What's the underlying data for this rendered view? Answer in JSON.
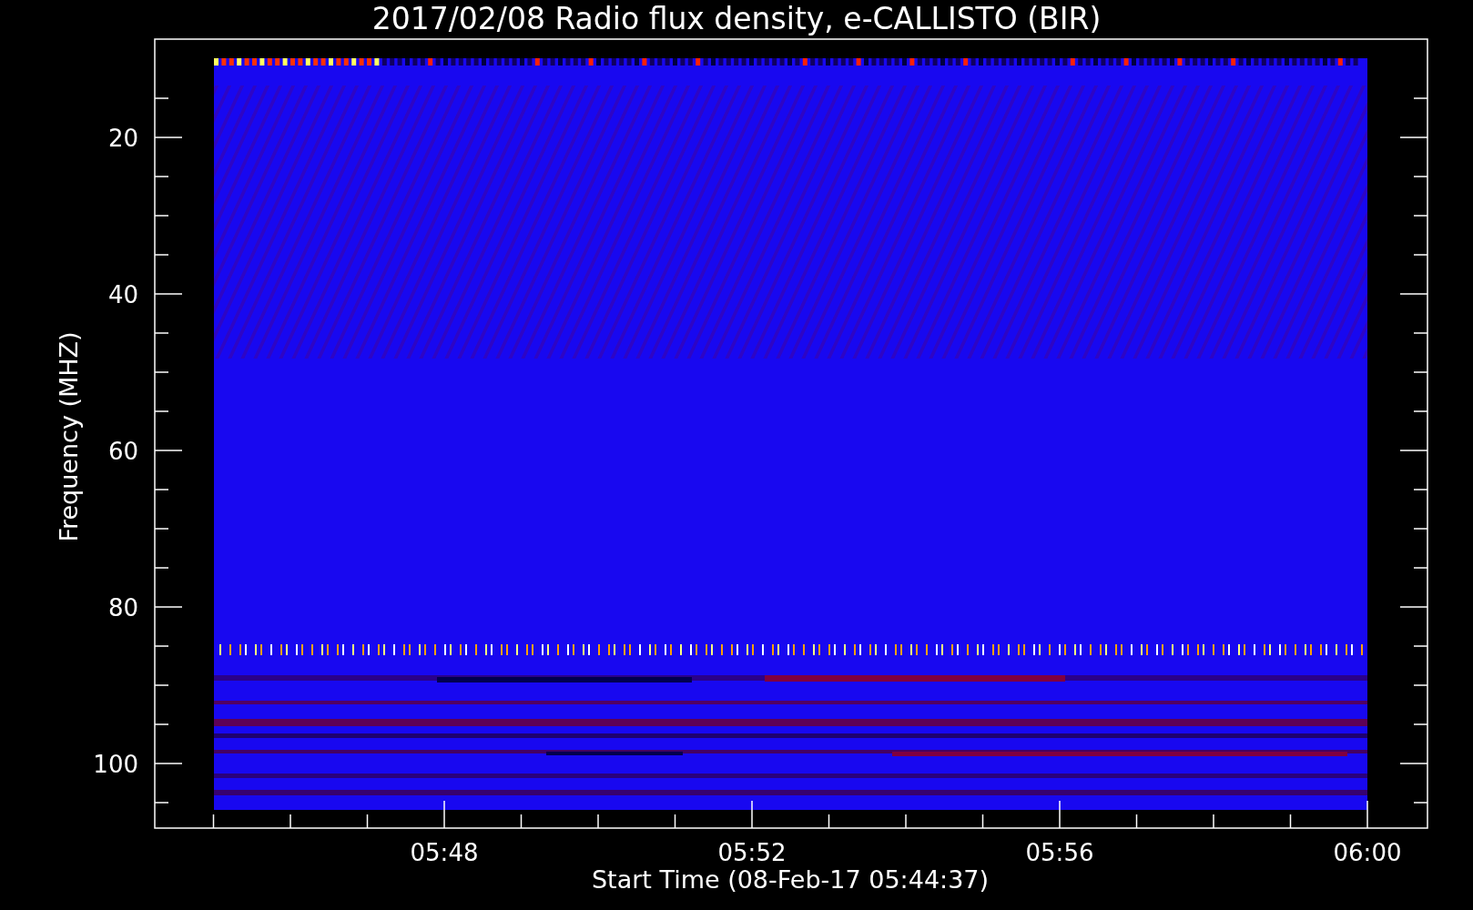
{
  "title": "2017/02/08  Radio flux density, e-CALLISTO (BIR)",
  "y_axis": {
    "label": "Frequency (MHZ)",
    "ticks": [
      "20",
      "40",
      "60",
      "80",
      "100"
    ]
  },
  "x_axis": {
    "label": "Start Time (08-Feb-17 05:44:37)",
    "ticks": [
      "05:48",
      "05:52",
      "05:56",
      "06:00"
    ]
  }
}
